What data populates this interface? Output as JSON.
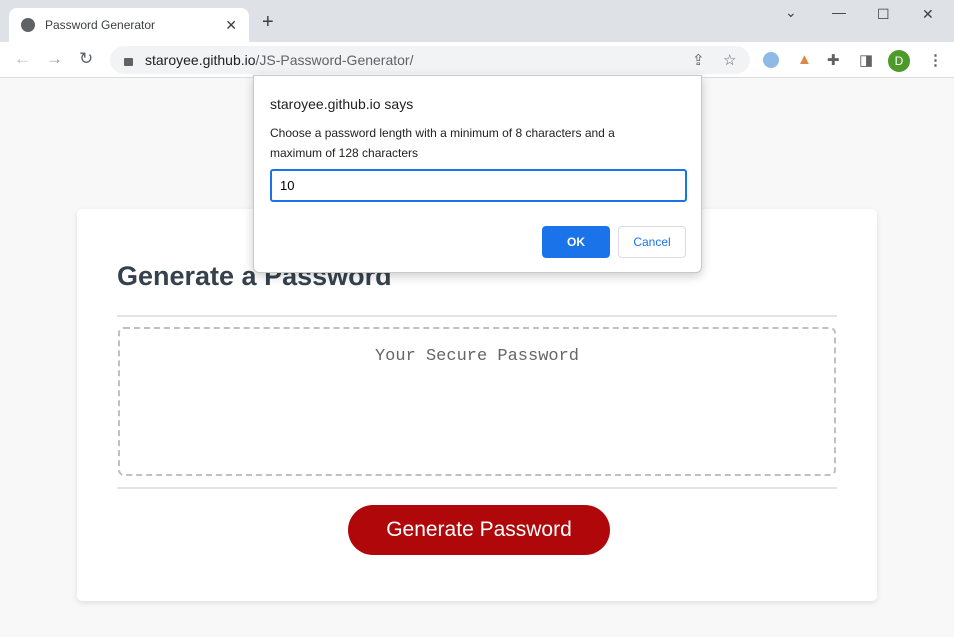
{
  "browser": {
    "tab_title": "Password Generator",
    "url_domain": "staroyee.github.io",
    "url_path": "/JS-Password-Generator/",
    "avatar_letter": "D"
  },
  "page": {
    "heading": "Generate a Password",
    "password_placeholder": "Your Secure Password",
    "generate_label": "Generate Password"
  },
  "dialog": {
    "origin": "staroyee.github.io says",
    "message": "Choose a password length with a minimum of 8 characters and a maximum of 128 characters",
    "input_value": "10",
    "ok_label": "OK",
    "cancel_label": "Cancel"
  }
}
